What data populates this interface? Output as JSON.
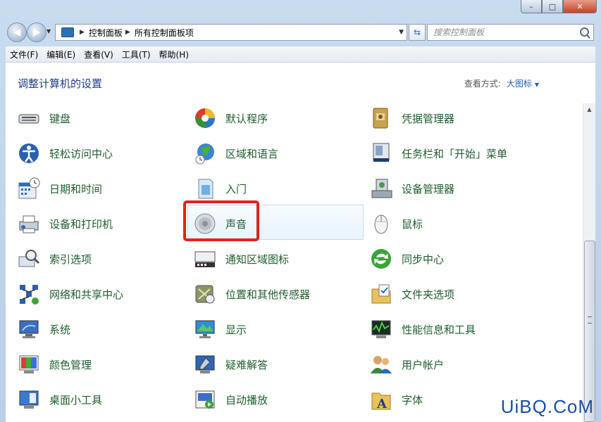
{
  "window": {
    "caption_buttons": [
      "–",
      "□",
      "✕"
    ]
  },
  "address": {
    "crumbs": [
      "控制面板",
      "所有控制面板项"
    ],
    "search_placeholder": "搜索控制面板"
  },
  "menu": {
    "items": [
      "文件(F)",
      "编辑(E)",
      "查看(V)",
      "工具(T)",
      "帮助(H)"
    ]
  },
  "header": {
    "title": "调整计算机的设置",
    "view_label": "查看方式:",
    "view_value": "大图标"
  },
  "items": [
    {
      "label": "键盘",
      "icon": "keyboard-icon"
    },
    {
      "label": "默认程序",
      "icon": "default-programs-icon"
    },
    {
      "label": "凭据管理器",
      "icon": "credential-manager-icon"
    },
    {
      "label": "轻松访问中心",
      "icon": "ease-of-access-icon"
    },
    {
      "label": "区域和语言",
      "icon": "region-language-icon"
    },
    {
      "label": "任务栏和「开始」菜单",
      "icon": "taskbar-icon"
    },
    {
      "label": "日期和时间",
      "icon": "date-time-icon"
    },
    {
      "label": "入门",
      "icon": "getting-started-icon"
    },
    {
      "label": "设备管理器",
      "icon": "device-manager-icon"
    },
    {
      "label": "设备和打印机",
      "icon": "printer-icon"
    },
    {
      "label": "声音",
      "icon": "speaker-icon"
    },
    {
      "label": "鼠标",
      "icon": "mouse-icon"
    },
    {
      "label": "索引选项",
      "icon": "indexing-icon"
    },
    {
      "label": "通知区域图标",
      "icon": "notification-area-icon"
    },
    {
      "label": "同步中心",
      "icon": "sync-center-icon"
    },
    {
      "label": "网络和共享中心",
      "icon": "network-icon"
    },
    {
      "label": "位置和其他传感器",
      "icon": "location-sensor-icon"
    },
    {
      "label": "文件夹选项",
      "icon": "folder-options-icon"
    },
    {
      "label": "系统",
      "icon": "system-icon"
    },
    {
      "label": "显示",
      "icon": "display-icon"
    },
    {
      "label": "性能信息和工具",
      "icon": "performance-icon"
    },
    {
      "label": "颜色管理",
      "icon": "color-management-icon"
    },
    {
      "label": "疑难解答",
      "icon": "troubleshooting-icon"
    },
    {
      "label": "用户帐户",
      "icon": "user-accounts-icon"
    },
    {
      "label": "桌面小工具",
      "icon": "gadgets-icon"
    },
    {
      "label": "自动播放",
      "icon": "autoplay-icon"
    },
    {
      "label": "字体",
      "icon": "fonts-icon"
    }
  ],
  "watermark": "UiBQ.CoM",
  "colors": {
    "link_green": "#1e5e2e",
    "title_blue": "#1e3f8a",
    "highlight_red": "#e81f1f"
  }
}
